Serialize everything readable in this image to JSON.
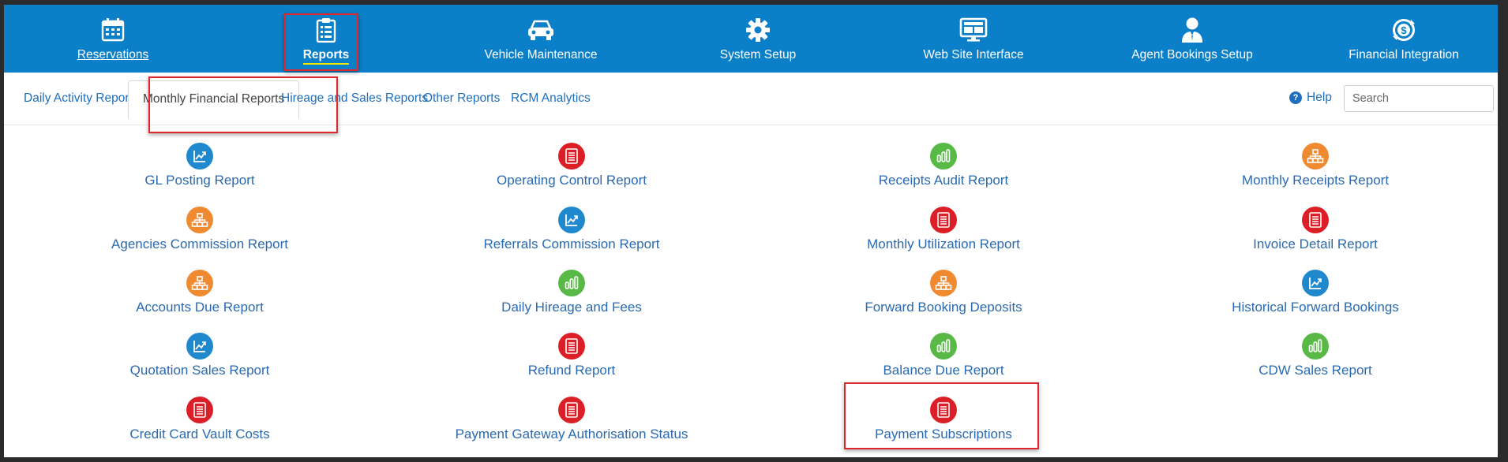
{
  "topnav": {
    "items": [
      {
        "label": "Reservations",
        "icon": "calendar-icon"
      },
      {
        "label": "Reports",
        "icon": "clipboard-list-icon"
      },
      {
        "label": "Vehicle Maintenance",
        "icon": "car-icon"
      },
      {
        "label": "System Setup",
        "icon": "gear-icon"
      },
      {
        "label": "Web Site Interface",
        "icon": "monitor-icon"
      },
      {
        "label": "Agent Bookings Setup",
        "icon": "agent-icon"
      },
      {
        "label": "Financial Integration",
        "icon": "dollar-sync-icon"
      }
    ],
    "active_index": 1,
    "nav_color": "#0b7fc7"
  },
  "subnav": {
    "tabs": [
      {
        "label": "Daily Activity Reports"
      },
      {
        "label": "Monthly Financial Reports"
      },
      {
        "label": "Hireage and Sales Reports"
      },
      {
        "label": "Other Reports"
      },
      {
        "label": "RCM Analytics"
      }
    ],
    "active_index": 1,
    "help_label": "Help",
    "search_placeholder": "Search"
  },
  "reports": {
    "col1": [
      {
        "label": "GL Posting Report",
        "icon": "line-chart-icon",
        "color": "blue"
      },
      {
        "label": "Agencies Commission Report",
        "icon": "hierarchy-icon",
        "color": "orange"
      },
      {
        "label": "Accounts Due Report",
        "icon": "hierarchy-icon",
        "color": "orange"
      },
      {
        "label": "Quotation Sales Report",
        "icon": "line-chart-icon",
        "color": "blue"
      },
      {
        "label": "Credit Card Vault Costs",
        "icon": "document-icon",
        "color": "red"
      }
    ],
    "col2": [
      {
        "label": "Operating Control Report",
        "icon": "document-icon",
        "color": "red"
      },
      {
        "label": "Referrals Commission Report",
        "icon": "line-chart-icon",
        "color": "blue"
      },
      {
        "label": "Daily Hireage and Fees",
        "icon": "bar-chart-icon",
        "color": "green"
      },
      {
        "label": "Refund Report",
        "icon": "document-icon",
        "color": "red"
      },
      {
        "label": "Payment Gateway Authorisation Status",
        "icon": "document-icon",
        "color": "red"
      }
    ],
    "col3": [
      {
        "label": "Receipts Audit Report",
        "icon": "bar-chart-icon",
        "color": "green"
      },
      {
        "label": "Monthly Utilization Report",
        "icon": "document-icon",
        "color": "red"
      },
      {
        "label": "Forward Booking Deposits",
        "icon": "hierarchy-icon",
        "color": "orange"
      },
      {
        "label": "Balance Due Report",
        "icon": "bar-chart-icon",
        "color": "green"
      },
      {
        "label": "Payment Subscriptions",
        "icon": "document-icon",
        "color": "red"
      }
    ],
    "col4": [
      {
        "label": "Monthly Receipts Report",
        "icon": "hierarchy-icon",
        "color": "orange"
      },
      {
        "label": "Invoice Detail Report",
        "icon": "document-icon",
        "color": "red"
      },
      {
        "label": "Historical Forward Bookings",
        "icon": "line-chart-icon",
        "color": "blue"
      },
      {
        "label": "CDW Sales Report",
        "icon": "bar-chart-icon",
        "color": "green"
      }
    ]
  },
  "colors": {
    "red": "#dc1f26",
    "blue": "#2089cd",
    "green": "#58b947",
    "orange": "#f08a31",
    "highlight": "#e0282c",
    "link": "#2a69b0"
  }
}
